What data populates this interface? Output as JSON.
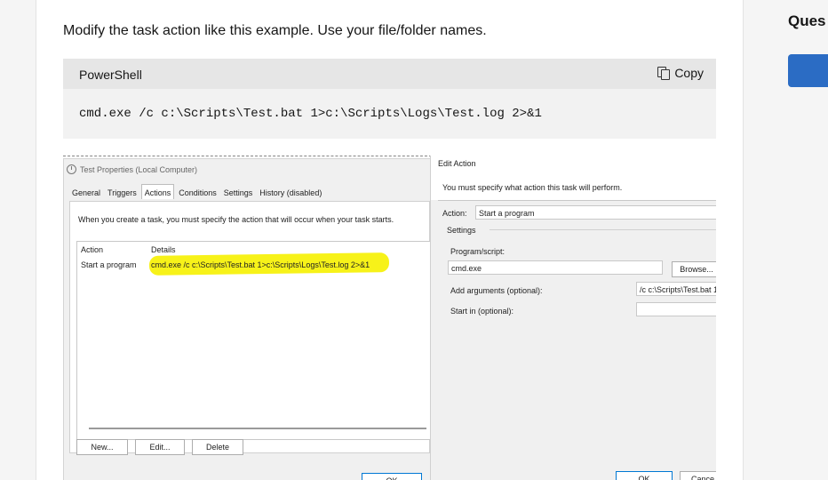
{
  "intro_text": "Modify the task action like this example. Use your file/folder names.",
  "code_block": {
    "language": "PowerShell",
    "copy_label": "Copy",
    "code": "cmd.exe /c c:\\Scripts\\Test.bat 1>c:\\Scripts\\Logs\\Test.log 2>&1"
  },
  "task_props": {
    "title": "Test Properties (Local Computer)",
    "tabs": [
      "General",
      "Triggers",
      "Actions",
      "Conditions",
      "Settings",
      "History (disabled)"
    ],
    "active_tab": "Actions",
    "description": "When you create a task, you must specify the action that will occur when your task starts.",
    "columns": [
      "Action",
      "Details"
    ],
    "row": {
      "action": "Start a program",
      "details": "cmd.exe /c c:\\Scripts\\Test.bat 1>c:\\Scripts\\Logs\\Test.log 2>&1"
    },
    "buttons": {
      "new": "New...",
      "edit": "Edit...",
      "delete": "Delete",
      "ok": "OK"
    },
    "highlight_color": "#f6f100"
  },
  "edit_action": {
    "title": "Edit Action",
    "description": "You must specify what action this task will perform.",
    "action_label": "Action:",
    "action_value": "Start a program",
    "settings_label": "Settings",
    "program_label": "Program/script:",
    "program_value": "cmd.exe",
    "browse_label": "Browse...",
    "args_label": "Add arguments (optional):",
    "args_value": "/c c:\\Scripts\\Test.bat 1",
    "start_in_label": "Start in (optional):",
    "ok_label": "OK",
    "cancel_label": "Cance"
  },
  "sidebar": {
    "title": "Ques",
    "button_color": "#2b6cc4"
  }
}
